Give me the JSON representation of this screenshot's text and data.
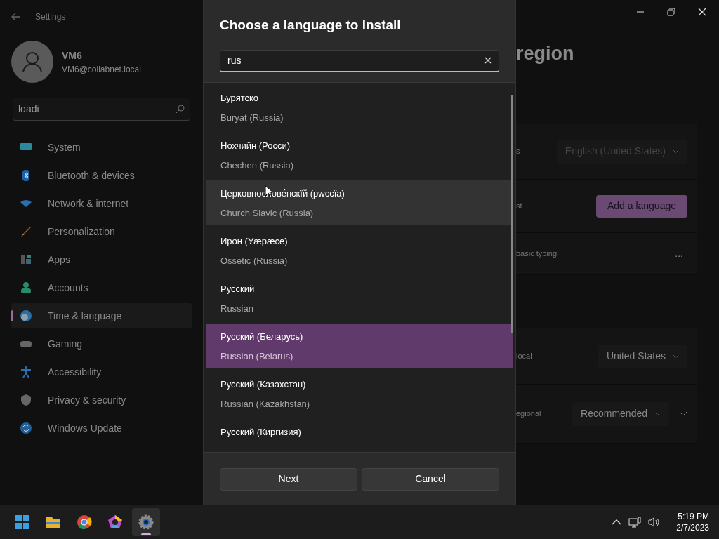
{
  "settings": {
    "title": "Settings",
    "user": {
      "name": "VM6",
      "email": "VM6@collabnet.local"
    },
    "search": {
      "value": "loadi"
    },
    "nav": [
      {
        "label": "System",
        "selected": false
      },
      {
        "label": "Bluetooth & devices",
        "selected": false
      },
      {
        "label": "Network & internet",
        "selected": false
      },
      {
        "label": "Personalization",
        "selected": false
      },
      {
        "label": "Apps",
        "selected": false
      },
      {
        "label": "Accounts",
        "selected": false
      },
      {
        "label": "Time & language",
        "selected": true
      },
      {
        "label": "Gaming",
        "selected": false
      },
      {
        "label": "Accessibility",
        "selected": false
      },
      {
        "label": "Privacy & security",
        "selected": false
      },
      {
        "label": "Windows Update",
        "selected": false
      }
    ],
    "page_title": "region",
    "rows": [
      {
        "label": "s",
        "kind": "dropdown",
        "value": "English (United States)",
        "disabled": true
      },
      {
        "label": "st",
        "kind": "button",
        "value": "Add a language"
      },
      {
        "label": "basic typing",
        "kind": "more",
        "value": "..."
      },
      {
        "label": "local",
        "kind": "dropdown",
        "value": "United States",
        "disabled": false
      },
      {
        "label": "egional",
        "kind": "dropdown-expand",
        "value": "Recommended",
        "disabled": false
      }
    ]
  },
  "dialog": {
    "title": "Choose a language to install",
    "search": {
      "value": "rus"
    },
    "languages": [
      {
        "native": "Бурятско",
        "english": "Buryat (Russia)",
        "selected": false,
        "hovered": false
      },
      {
        "native": "Нохчийн (Росси)",
        "english": "Chechen (Russia)",
        "selected": false,
        "hovered": false
      },
      {
        "native": "Церковнослове́нскїй (рwссїа)",
        "english": "Church Slavic (Russia)",
        "selected": false,
        "hovered": true
      },
      {
        "native": "Ирон (Уæрæсе)",
        "english": "Ossetic (Russia)",
        "selected": false,
        "hovered": false
      },
      {
        "native": "Русский",
        "english": "Russian",
        "selected": false,
        "hovered": false
      },
      {
        "native": "Русский (Беларусь)",
        "english": "Russian (Belarus)",
        "selected": true,
        "hovered": false
      },
      {
        "native": "Русский (Казахстан)",
        "english": "Russian (Kazakhstan)",
        "selected": false,
        "hovered": false
      },
      {
        "native": "Русский (Киргизия)",
        "selected": false,
        "hovered": false
      }
    ],
    "buttons": [
      "Next",
      "Cancel"
    ]
  },
  "taskbar": {
    "apps": [
      {
        "active": false
      },
      {
        "active": false
      },
      {
        "active": false
      },
      {
        "active": false
      },
      {
        "active": true
      }
    ],
    "time": "5:19 PM",
    "date": "2/7/2023"
  }
}
